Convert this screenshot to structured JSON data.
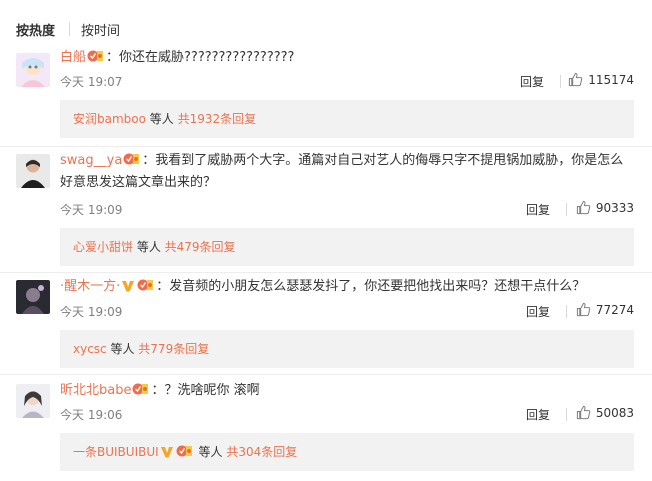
{
  "sort": {
    "hot": "按热度",
    "time": "按时间"
  },
  "comments": [
    {
      "user": "白船",
      "text": "：你还在威胁????????????????",
      "line2": "",
      "time": "今天 19:07",
      "reply": "回复",
      "likes": "115174",
      "sub_user": "安润bamboo",
      "sub_suffix": " 等人 ",
      "sub_count": "共1932条回复"
    },
    {
      "user": "swag__ya",
      "text": "：我看到了威胁两个大字。通篇对自己对艺人的侮辱只字不提甩锅加威胁，你是怎么",
      "line2": "好意思发这篇文章出来的？",
      "time": "今天 19:09",
      "reply": "回复",
      "likes": "90333",
      "sub_user": "心爱小甜饼",
      "sub_suffix": " 等人 ",
      "sub_count": "共479条回复"
    },
    {
      "user": "·醒木一方·",
      "text": "：发音频的小朋友怎么瑟瑟发抖了，你还要把他找出来吗？还想干点什么？",
      "line2": "",
      "time": "今天 19:09",
      "reply": "回复",
      "likes": "77274",
      "sub_user": "xycsc",
      "sub_suffix": " 等人 ",
      "sub_count": "共779条回复"
    },
    {
      "user": "昕北北babe",
      "text": "：？洗啥呢你 滚啊",
      "line2": "",
      "time": "今天 19:06",
      "reply": "回复",
      "likes": "50083",
      "sub_user": "一条BUIBUIBUI",
      "sub_suffix": " 等人 ",
      "sub_count": "共304条回复"
    }
  ],
  "colors": {
    "username": "#eb7350",
    "subbg": "#f2f2f2",
    "vip": "#f5a623"
  },
  "icons": {
    "like": "thumbs-up-icon",
    "vip": "vip-v-icon",
    "badge": "fan-badge-icon"
  }
}
